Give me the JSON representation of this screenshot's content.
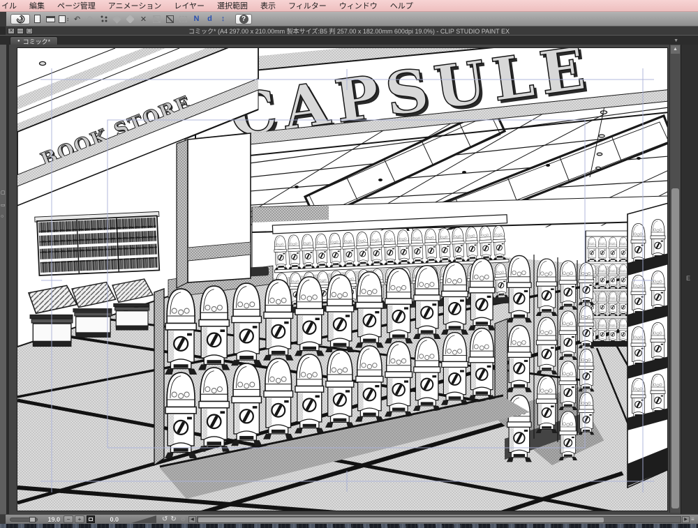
{
  "app": {
    "name": "CLIP STUDIO PAINT EX",
    "title_bar": "コミック* (A4 297.00 x 210.00mm 製本サイズ:B5 判 257.00 x 182.00mm 600dpi 19.0%)  - CLIP STUDIO PAINT EX"
  },
  "menu_bar": {
    "items": [
      "イル",
      "編集",
      "ページ管理",
      "アニメーション",
      "レイヤー",
      "選択範囲",
      "表示",
      "フィルター",
      "ウィンドウ",
      "ヘルプ"
    ]
  },
  "toolbar": {
    "icons": [
      "clip-studio-logo",
      "new-file",
      "open-file",
      "save-file",
      "undo",
      "redo",
      "snap-scatter",
      "snap-shape",
      "fill-tool",
      "transform",
      "ruler-1-disabled",
      "ruler-2-disabled",
      "selection-disabled",
      "pen-n",
      "pen-d",
      "swap-updown",
      "help"
    ],
    "letter_n": "N",
    "letter_d": "d",
    "updown_glyph": "↕",
    "undo_glyph": "↶",
    "redo_glyph": "↷",
    "help_label": "?"
  },
  "document_tab": {
    "bullet": "●",
    "label": "コミック*"
  },
  "window_buttons": {
    "close": "✕",
    "minimize": "—",
    "maximize": "▢"
  },
  "canvas": {
    "sign_capsule": "CAPSULE",
    "sign_book_store": "BOOK STORE"
  },
  "workspace": {
    "right_edge_label": "E",
    "tab_caret": "▼",
    "vscroll_up": "▲"
  },
  "status_bar": {
    "zoom_value": "19.0",
    "rotate_value": "0.0",
    "zoom_out_glyph": "−",
    "zoom_in_glyph": "+",
    "rotate_ccw_glyph": "↺",
    "rotate_cw_glyph": "↻",
    "gear_glyph": "☼",
    "left_arrow": "◀",
    "right_arrow": "▶",
    "grip": "≡"
  },
  "colors": {
    "menubar_pink": "#f2c7c7",
    "titlebar": "#3b3b3b",
    "pasteboard": "#454545",
    "guide_blue": "#a8b0d8",
    "accent_blue": "#2a4fae"
  }
}
